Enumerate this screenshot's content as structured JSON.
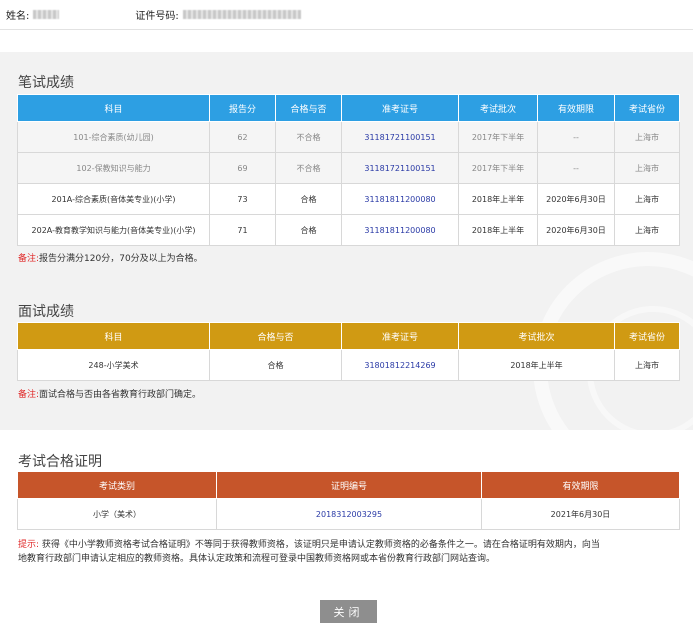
{
  "header": {
    "name_label": "姓名:",
    "id_label": "证件号码:"
  },
  "written": {
    "title": "笔试成绩",
    "columns": [
      "科目",
      "报告分",
      "合格与否",
      "准考证号",
      "考试批次",
      "有效期限",
      "考试省份"
    ],
    "rows": [
      {
        "subject": "101-综合素质(幼儿园)",
        "score": "62",
        "pass": "不合格",
        "ticket": "31181721100151",
        "batch": "2017年下半年",
        "valid": "--",
        "province": "上海市"
      },
      {
        "subject": "102-保教知识与能力",
        "score": "69",
        "pass": "不合格",
        "ticket": "31181721100151",
        "batch": "2017年下半年",
        "valid": "--",
        "province": "上海市"
      },
      {
        "subject": "201A-综合素质(音体美专业)(小学)",
        "score": "73",
        "pass": "合格",
        "ticket": "31181811200080",
        "batch": "2018年上半年",
        "valid": "2020年6月30日",
        "province": "上海市"
      },
      {
        "subject": "202A-教育教学知识与能力(音体美专业)(小学)",
        "score": "71",
        "pass": "合格",
        "ticket": "31181811200080",
        "batch": "2018年上半年",
        "valid": "2020年6月30日",
        "province": "上海市"
      }
    ],
    "note_label": "备注:",
    "note_text": "报告分满分120分，70分及以上为合格。"
  },
  "interview": {
    "title": "面试成绩",
    "columns": [
      "科目",
      "合格与否",
      "准考证号",
      "考试批次",
      "考试省份"
    ],
    "rows": [
      {
        "subject": "248-小学美术",
        "pass": "合格",
        "ticket": "31801812214269",
        "batch": "2018年上半年",
        "province": "上海市"
      }
    ],
    "note_label": "备注:",
    "note_text": "面试合格与否由各省教育行政部门确定。"
  },
  "certificate": {
    "title": "考试合格证明",
    "columns": [
      "考试类别",
      "证明编号",
      "有效期限"
    ],
    "rows": [
      {
        "category": "小学（美术）",
        "number": "2018312003295",
        "valid": "2021年6月30日"
      }
    ],
    "tip_label": "提示:",
    "tip_line1": "获得《中小学教师资格考试合格证明》不等同于获得教师资格，该证明只是申请认定教师资格的必备条件之一。请在合格证明有效期内，向当",
    "tip_line2": "地教育行政部门申请认定相应的教师资格。具体认定政策和流程可登录中国教师资格网或本省份教育行政部门网站查询。"
  },
  "close_label": "关闭"
}
